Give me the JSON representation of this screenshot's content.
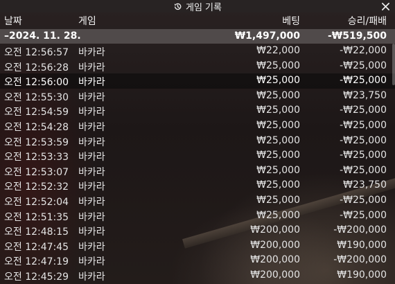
{
  "window": {
    "title": "게임 기록",
    "title_icon": "history-icon",
    "close_icon": "close-icon"
  },
  "columns": {
    "date": "날짜",
    "game": "게임",
    "bet": "베팅",
    "result": "승리/패배"
  },
  "summary": {
    "date": "–2024. 11. 28.",
    "bet": "₩1,497,000",
    "result": "-₩519,500"
  },
  "rows": [
    {
      "time": "오전 12:56:57",
      "game": "바카라",
      "bet": "₩22,000",
      "result": "-₩22,000"
    },
    {
      "time": "오전 12:56:28",
      "game": "바카라",
      "bet": "₩25,000",
      "result": "-₩25,000"
    },
    {
      "time": "오전 12:56:00",
      "game": "바카라",
      "bet": "₩25,000",
      "result": "-₩25,000"
    },
    {
      "time": "오전 12:55:30",
      "game": "바카라",
      "bet": "₩25,000",
      "result": "₩23,750"
    },
    {
      "time": "오전 12:54:59",
      "game": "바카라",
      "bet": "₩25,000",
      "result": "-₩25,000"
    },
    {
      "time": "오전 12:54:28",
      "game": "바카라",
      "bet": "₩25,000",
      "result": "-₩25,000"
    },
    {
      "time": "오전 12:53:59",
      "game": "바카라",
      "bet": "₩25,000",
      "result": "-₩25,000"
    },
    {
      "time": "오전 12:53:33",
      "game": "바카라",
      "bet": "₩25,000",
      "result": "-₩25,000"
    },
    {
      "time": "오전 12:53:07",
      "game": "바카라",
      "bet": "₩25,000",
      "result": "-₩25,000"
    },
    {
      "time": "오전 12:52:32",
      "game": "바카라",
      "bet": "₩25,000",
      "result": "₩23,750"
    },
    {
      "time": "오전 12:52:04",
      "game": "바카라",
      "bet": "₩25,000",
      "result": "-₩25,000"
    },
    {
      "time": "오전 12:51:35",
      "game": "바카라",
      "bet": "₩25,000",
      "result": "-₩25,000"
    },
    {
      "time": "오전 12:48:15",
      "game": "바카라",
      "bet": "₩200,000",
      "result": "-₩200,000"
    },
    {
      "time": "오전 12:47:45",
      "game": "바카라",
      "bet": "₩200,000",
      "result": "₩190,000"
    },
    {
      "time": "오전 12:47:19",
      "game": "바카라",
      "bet": "₩200,000",
      "result": "-₩200,000"
    },
    {
      "time": "오전 12:45:29",
      "game": "바카라",
      "bet": "₩200,000",
      "result": "₩190,000"
    }
  ]
}
